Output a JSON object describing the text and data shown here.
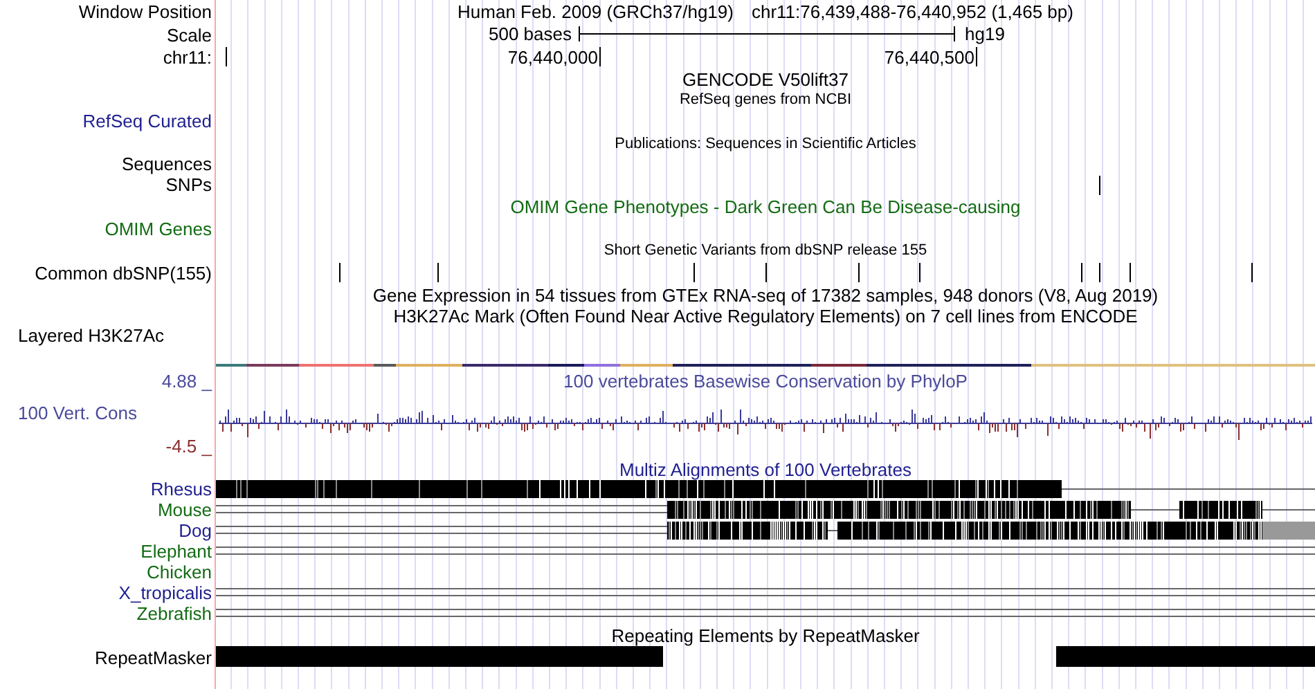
{
  "header": {
    "label": "Window Position",
    "assembly": "Human Feb. 2009 (GRCh37/hg19)",
    "position": "chr11:76,439,488-76,440,952 (1,465 bp)"
  },
  "scale": {
    "label": "Scale",
    "length": "500 bases",
    "assembly": "hg19"
  },
  "ruler": {
    "label": "chr11:",
    "ticks": [
      "76,440,000",
      "76,440,500"
    ]
  },
  "tracks": [
    {
      "kind": "title",
      "title": "GENCODE V50lift37"
    },
    {
      "kind": "refseq",
      "title": "RefSeq genes from NCBI",
      "label": "RefSeq Curated",
      "color": "#1f1f8f"
    },
    {
      "kind": "publications",
      "title": "Publications: Sequences in Scientific Articles",
      "labels": [
        "Sequences",
        "SNPs"
      ]
    },
    {
      "kind": "omim",
      "title": "OMIM Gene Phenotypes - Dark Green Can Be Disease-causing",
      "label": "OMIM Genes",
      "color": "#136b13"
    },
    {
      "kind": "snps",
      "title": "Short Genetic Variants from dbSNP release 155",
      "label": "Common dbSNP(155)"
    },
    {
      "kind": "title",
      "title": "Gene Expression in 54 tissues from GTEx RNA-seq of 17382 samples, 948 donors (V8, Aug 2019)"
    },
    {
      "kind": "layered",
      "title": "H3K27Ac Mark (Often Found Near Active Regulatory Elements) on 7 cell lines from ENCODE",
      "label": "Layered H3K27Ac"
    },
    {
      "kind": "conservation",
      "title": "100 vertebrates Basewise Conservation by PhyloP",
      "label": "100 Vert. Cons",
      "max": "4.88 _",
      "min": "-4.5 _"
    },
    {
      "kind": "multiz",
      "title": "Multiz Alignments of 100 Vertebrates",
      "species": [
        {
          "name": "Rhesus",
          "color": "#1f1f8f"
        },
        {
          "name": "Mouse",
          "color": "#136b13"
        },
        {
          "name": "Dog",
          "color": "#1f1f8f"
        },
        {
          "name": "Elephant",
          "color": "#136b13"
        },
        {
          "name": "Chicken",
          "color": "#136b13"
        },
        {
          "name": "X_tropicalis",
          "color": "#1f1f8f"
        },
        {
          "name": "Zebrafish",
          "color": "#136b13"
        }
      ]
    },
    {
      "kind": "repeats",
      "title": "Repeating Elements by RepeatMasker",
      "label": "RepeatMasker"
    }
  ]
}
